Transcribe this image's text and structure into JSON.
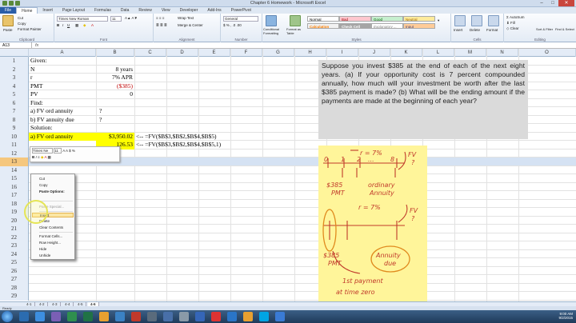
{
  "window": {
    "title": "Chapter 6 Homework - Microsoft Excel"
  },
  "ribbon_tabs": [
    "File",
    "Home",
    "Insert",
    "Page Layout",
    "Formulas",
    "Data",
    "Review",
    "View",
    "Developer",
    "Add-Ins",
    "PowerPivot"
  ],
  "ribbon": {
    "clipboard": {
      "paste": "Paste",
      "cut": "Cut",
      "copy": "Copy",
      "format_painter": "Format Painter",
      "label": "Clipboard"
    },
    "font": {
      "name": "Times New Roman",
      "size": "11",
      "label": "Font"
    },
    "alignment": {
      "wrap": "Wrap Text",
      "merge": "Merge & Center",
      "label": "Alignment"
    },
    "number": {
      "format": "General",
      "label": "Number"
    },
    "styles": {
      "conditional": "Conditional Formatting",
      "format_table": "Format as Table",
      "normal": "Normal",
      "bad": "Bad",
      "good": "Good",
      "neutral": "Neutral",
      "calculation": "Calculation",
      "check_cell": "Check Cell",
      "explanatory": "Explanatory ...",
      "input": "Input",
      "label": "Styles"
    },
    "cells": {
      "insert": "Insert",
      "delete": "Delete",
      "format": "Format",
      "label": "Cells"
    },
    "editing": {
      "autosum": "AutoSum",
      "fill": "Fill",
      "clear": "Clear",
      "sort": "Sort & Filter",
      "find": "Find & Select",
      "label": "Editing"
    }
  },
  "formula_bar": {
    "name_box": "A13",
    "fx": "fx"
  },
  "columns": [
    "A",
    "B",
    "C",
    "D",
    "E",
    "F",
    "G",
    "H",
    "I",
    "J",
    "K",
    "L",
    "M",
    "N",
    "O"
  ],
  "rows": [
    {
      "num": "1",
      "a": "Given:",
      "b": "",
      "c": ""
    },
    {
      "num": "2",
      "a": "N",
      "b": "8 years",
      "c": ""
    },
    {
      "num": "3",
      "a": "r",
      "b": "7% APR",
      "c": ""
    },
    {
      "num": "4",
      "a": "PMT",
      "b": "($385)",
      "c": ""
    },
    {
      "num": "5",
      "a": "PV",
      "b": "0",
      "c": ""
    },
    {
      "num": "6",
      "a": "Find:",
      "b": "",
      "c": ""
    },
    {
      "num": "7",
      "a": "a) FV ord annuity",
      "b": "?",
      "c": ""
    },
    {
      "num": "8",
      "a": "b) FV annuity due",
      "b": "?",
      "c": ""
    },
    {
      "num": "9",
      "a": "Solution:",
      "b": "",
      "c": ""
    },
    {
      "num": "10",
      "a": "a) FV ord annuity",
      "b": "$3,950.02",
      "c": "<-- =FV($B$3,$B$2,$B$4,$B$5)"
    },
    {
      "num": "11",
      "a": "",
      "b": "126.53",
      "c": "<-- =FV($B$3,$B$2,$B$4,$B$5,1)"
    },
    {
      "num": "12",
      "a": "",
      "b": "",
      "c": ""
    },
    {
      "num": "13",
      "a": "",
      "b": "",
      "c": ""
    },
    {
      "num": "14",
      "a": "",
      "b": "",
      "c": ""
    },
    {
      "num": "15",
      "a": "",
      "b": "",
      "c": ""
    },
    {
      "num": "16",
      "a": "",
      "b": "",
      "c": ""
    },
    {
      "num": "17",
      "a": "",
      "b": "",
      "c": ""
    },
    {
      "num": "18",
      "a": "",
      "b": "",
      "c": ""
    },
    {
      "num": "19",
      "a": "",
      "b": "",
      "c": ""
    },
    {
      "num": "20",
      "a": "",
      "b": "",
      "c": ""
    },
    {
      "num": "21",
      "a": "",
      "b": "",
      "c": ""
    },
    {
      "num": "22",
      "a": "",
      "b": "",
      "c": ""
    },
    {
      "num": "23",
      "a": "",
      "b": "",
      "c": ""
    },
    {
      "num": "24",
      "a": "",
      "b": "",
      "c": ""
    },
    {
      "num": "25",
      "a": "",
      "b": "",
      "c": ""
    },
    {
      "num": "26",
      "a": "",
      "b": "",
      "c": ""
    },
    {
      "num": "27",
      "a": "",
      "b": "",
      "c": ""
    },
    {
      "num": "28",
      "a": "",
      "b": "",
      "c": ""
    },
    {
      "num": "29",
      "a": "",
      "b": "",
      "c": ""
    }
  ],
  "problem_text": "Suppose you invest $385 at the end of each of the next eight years. (a) If your opportunity cost is 7 percent compounded annually, how much will your investment be worth after the last $385 payment is made? (b) What will be the ending amount if the payments are made at the beginning of each year?",
  "sketch": {
    "r1": "r = 7%",
    "t0": "0",
    "t1": "1",
    "t2": "2",
    "tdots": "...",
    "t8": "8",
    "fv1": "FV",
    "fv1b": "?",
    "pmt1": "$385",
    "pmt1b": "PMT",
    "ord": "ordinary",
    "ord2": "Annuity",
    "r2": "r = 7%",
    "fv2": "FV",
    "fv2b": "?",
    "pmt2": "$385",
    "pmt2b": "PMT",
    "due1": "Annuity",
    "due2": "due",
    "first": "1st payment",
    "zero": "at time zero"
  },
  "mini_toolbar": {
    "font": "Times Ne",
    "size": "11",
    "currency": "$",
    "percent": "%"
  },
  "context_menu": [
    "Cut",
    "Copy",
    "Paste Options:",
    "Paste Special...",
    "Insert",
    "Delete",
    "Clear Contents",
    "Format Cells...",
    "Row Height...",
    "Hide",
    "Unhide"
  ],
  "sheet_tabs": [
    "4-1",
    "4-2",
    "4-3",
    "4-4",
    "4-5",
    "4-6"
  ],
  "status": "Ready",
  "clock": {
    "time": "9:00 AM",
    "date": "9/2/2015"
  },
  "colors": {
    "highlight": "#ffff00",
    "negative": "#c00000",
    "sketch_bg": "#fff59a",
    "ink": "#c0392b",
    "ink_orange": "#e08a1e"
  }
}
